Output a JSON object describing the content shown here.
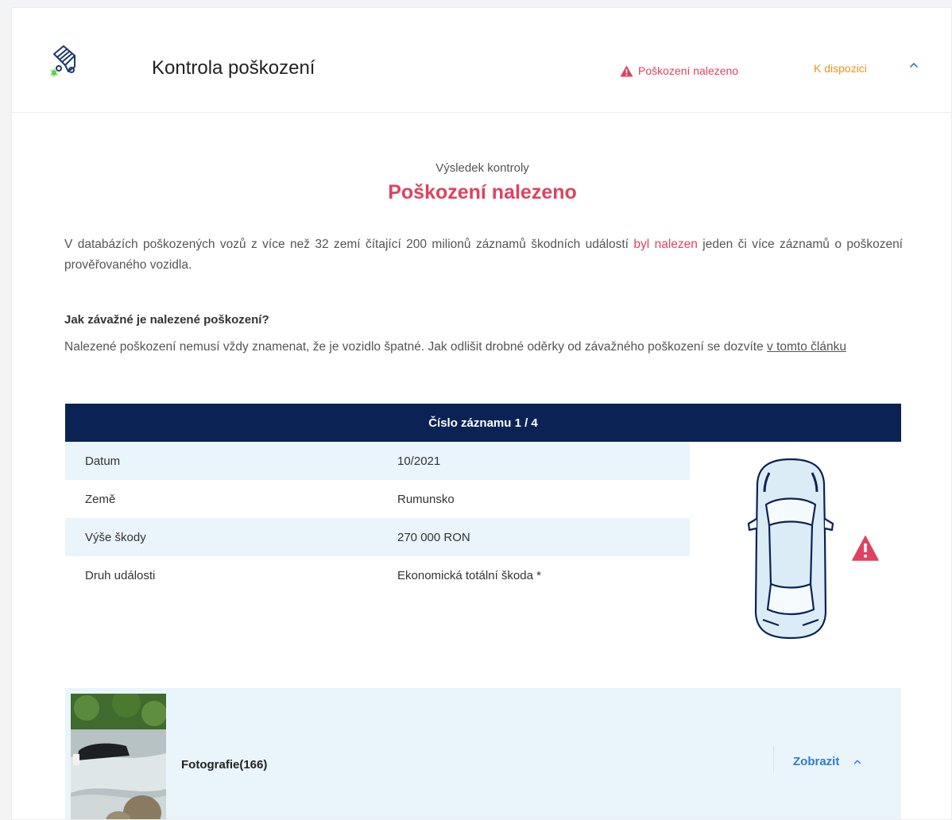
{
  "header": {
    "title": "Kontrola poškození",
    "status_found": "Poškození nalezeno",
    "status_available": "K dispozici",
    "logo_icon": "car-damage-logo-icon"
  },
  "result": {
    "subtitle": "Výsledek kontroly",
    "headline": "Poškození nalezeno",
    "intro_before": "V databázích poškozených vozů z více než 32 zemí čítající 200 milionů záznamů škodních událostí ",
    "intro_highlight": "byl nalezen",
    "intro_after": " jeden či více záznamů o poškození prověřovaného vozidla.",
    "question_title": "Jak závažné je nalezené poškození?",
    "question_text": "Nalezené poškození nemusí vždy znamenat, že je vozidlo špatné. Jak odlišit drobné oděrky od závažného poškození se dozvíte ",
    "question_link": "v tomto článku"
  },
  "record": {
    "title": "Číslo záznamu 1 / 4",
    "rows": [
      {
        "label": "Datum",
        "value": "10/2021"
      },
      {
        "label": "Země",
        "value": "Rumunsko"
      },
      {
        "label": "Výše škody",
        "value": "270 000 RON"
      },
      {
        "label": "Druh události",
        "value": "Ekonomická totální škoda *"
      }
    ]
  },
  "photos": {
    "label": "Fotografie(166)",
    "button": "Zobrazit"
  },
  "colors": {
    "accent_red": "#e0415e",
    "accent_orange": "#f0931b",
    "navy": "#0b2254",
    "light_blue": "#eaf4fb",
    "link_blue": "#2e7bd6"
  }
}
